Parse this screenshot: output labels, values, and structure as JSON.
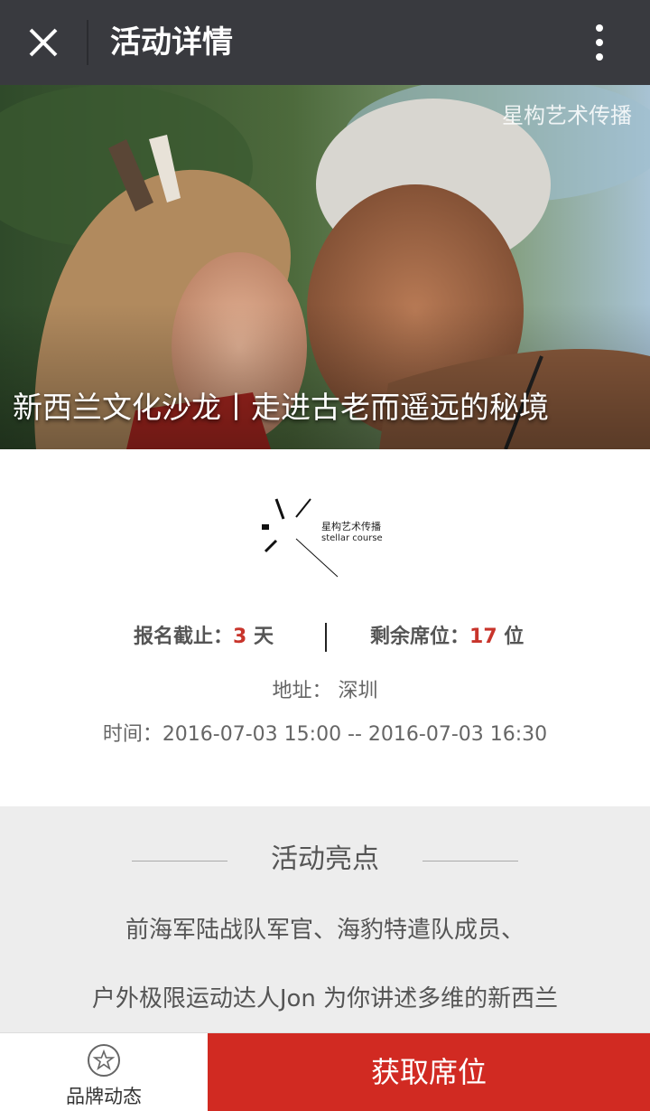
{
  "header": {
    "title": "活动详情",
    "close_icon": "close-icon",
    "more_icon": "more-vertical-icon"
  },
  "hero": {
    "watermark": "星构艺术传播",
    "title": "新西兰文化沙龙丨走进古老而遥远的秘境"
  },
  "logo": {
    "cn": "星构艺术传播",
    "en": "stellar course"
  },
  "stats": {
    "deadline_label": "报名截止：",
    "deadline_value": "3",
    "deadline_unit": " 天",
    "seats_label": "剩余席位：",
    "seats_value": "17",
    "seats_unit": " 位"
  },
  "info": {
    "address": "地址：  深圳",
    "time": "时间：2016-07-03 15:00 -- 2016-07-03 16:30"
  },
  "highlights": {
    "title": "活动亮点",
    "line1": "前海军陆战队军官、海豹特遣队成员、",
    "line2": "户外极限运动达人Jon 为你讲述多维的新西兰"
  },
  "bottom": {
    "brand_label": "品牌动态",
    "brand_icon": "star-circle-icon",
    "cta_label": "获取席位"
  },
  "colors": {
    "topbar": "#393a3f",
    "accent_red": "#d12a22",
    "number_red": "#c8342b",
    "highlights_bg": "#ededed"
  }
}
